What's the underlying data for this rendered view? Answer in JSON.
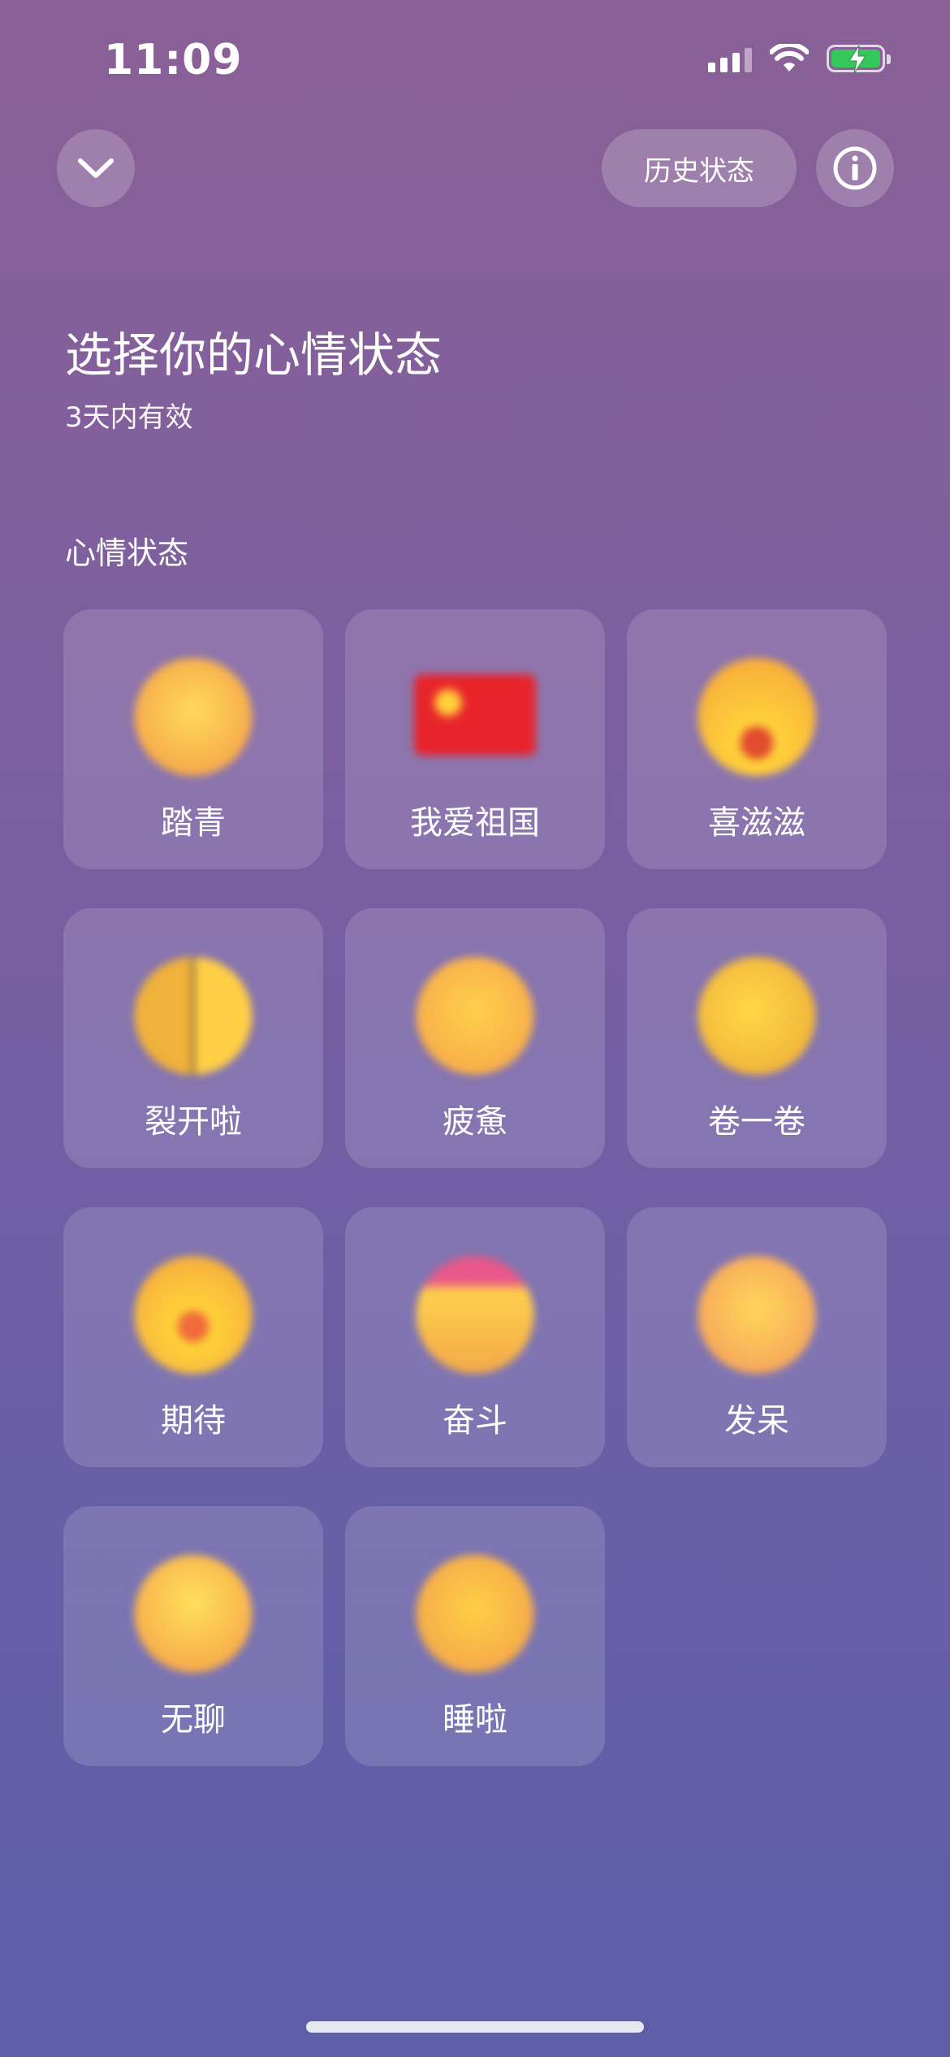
{
  "status_bar": {
    "time": "11:09"
  },
  "header": {
    "history_label": "历史状态"
  },
  "page": {
    "title": "选择你的心情状态",
    "subtitle": "3天内有效",
    "section_label": "心情状态"
  },
  "moods": [
    {
      "label": "踏青",
      "icon": "spring-outing-emoji-icon",
      "color": "#f7c84a"
    },
    {
      "label": "我爱祖国",
      "icon": "china-flag-icon",
      "color": "#e8242b"
    },
    {
      "label": "喜滋滋",
      "icon": "happy-face-icon",
      "color": "#f9c231"
    },
    {
      "label": "裂开啦",
      "icon": "cracked-face-icon",
      "color": "#f5b93a"
    },
    {
      "label": "疲惫",
      "icon": "tired-face-icon",
      "color": "#f8b84a"
    },
    {
      "label": "卷一卷",
      "icon": "curling-face-icon",
      "color": "#f4c233"
    },
    {
      "label": "期待",
      "icon": "expecting-face-icon",
      "color": "#f7c43a"
    },
    {
      "label": "奋斗",
      "icon": "striving-face-icon",
      "color": "#f6b846"
    },
    {
      "label": "发呆",
      "icon": "daze-face-icon",
      "color": "#f9b750"
    },
    {
      "label": "无聊",
      "icon": "bored-face-icon",
      "color": "#fbbf49"
    },
    {
      "label": "睡啦",
      "icon": "sleeping-face-icon",
      "color": "#f7b446"
    }
  ],
  "colors": {
    "battery": "#34c759",
    "background_top": "#8a6096",
    "background_bottom": "#5d5ea8"
  }
}
